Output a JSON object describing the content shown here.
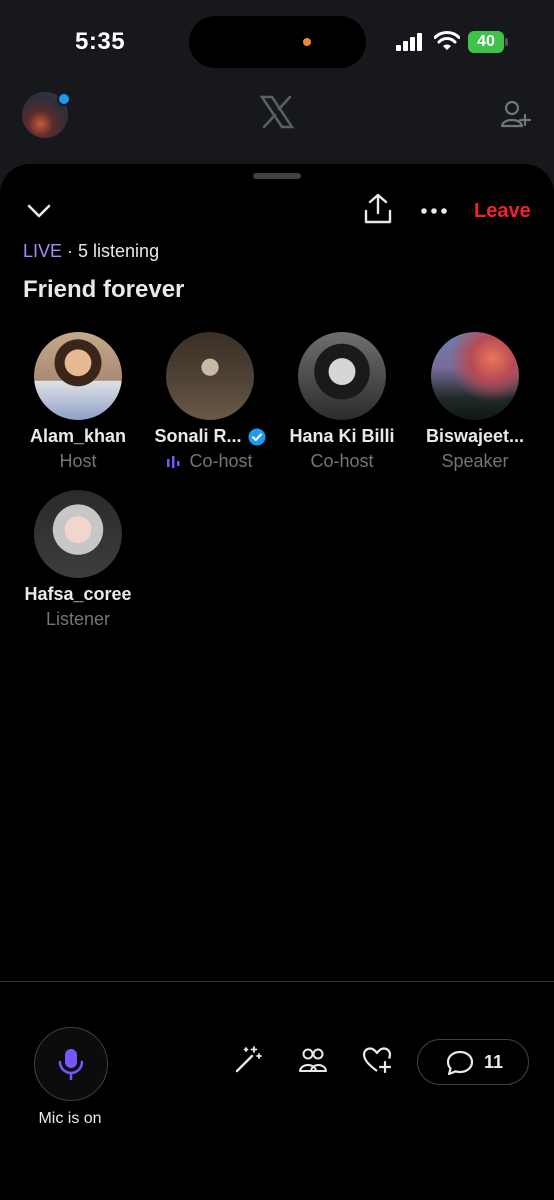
{
  "status_bar": {
    "time": "5:35",
    "battery": "40"
  },
  "space": {
    "live_label": "LIVE",
    "listening": " · 5 listening",
    "title": "Friend forever",
    "leave_label": "Leave"
  },
  "participants": [
    {
      "name": "Alam_khan",
      "role": "Host"
    },
    {
      "name": "Sonali R...",
      "role": "Co-host"
    },
    {
      "name": "Hana Ki Billi",
      "role": "Co-host"
    },
    {
      "name": "Biswajeet...",
      "role": "Speaker"
    },
    {
      "name": "Hafsa_coree",
      "role": "Listener"
    }
  ],
  "controls": {
    "mic_label": "Mic is on",
    "comments_count": "11"
  },
  "colors": {
    "accent": "#7856ff",
    "leave": "#f4212e",
    "live": "#a78bfa",
    "verified": "#1d9bf0"
  },
  "icons": [
    "x-logo-icon",
    "add-user-icon",
    "chevron-down-icon",
    "share-icon",
    "more-icon",
    "verified-icon",
    "mic-icon",
    "magic-wand-icon",
    "people-icon",
    "heart-plus-icon",
    "comment-icon"
  ]
}
